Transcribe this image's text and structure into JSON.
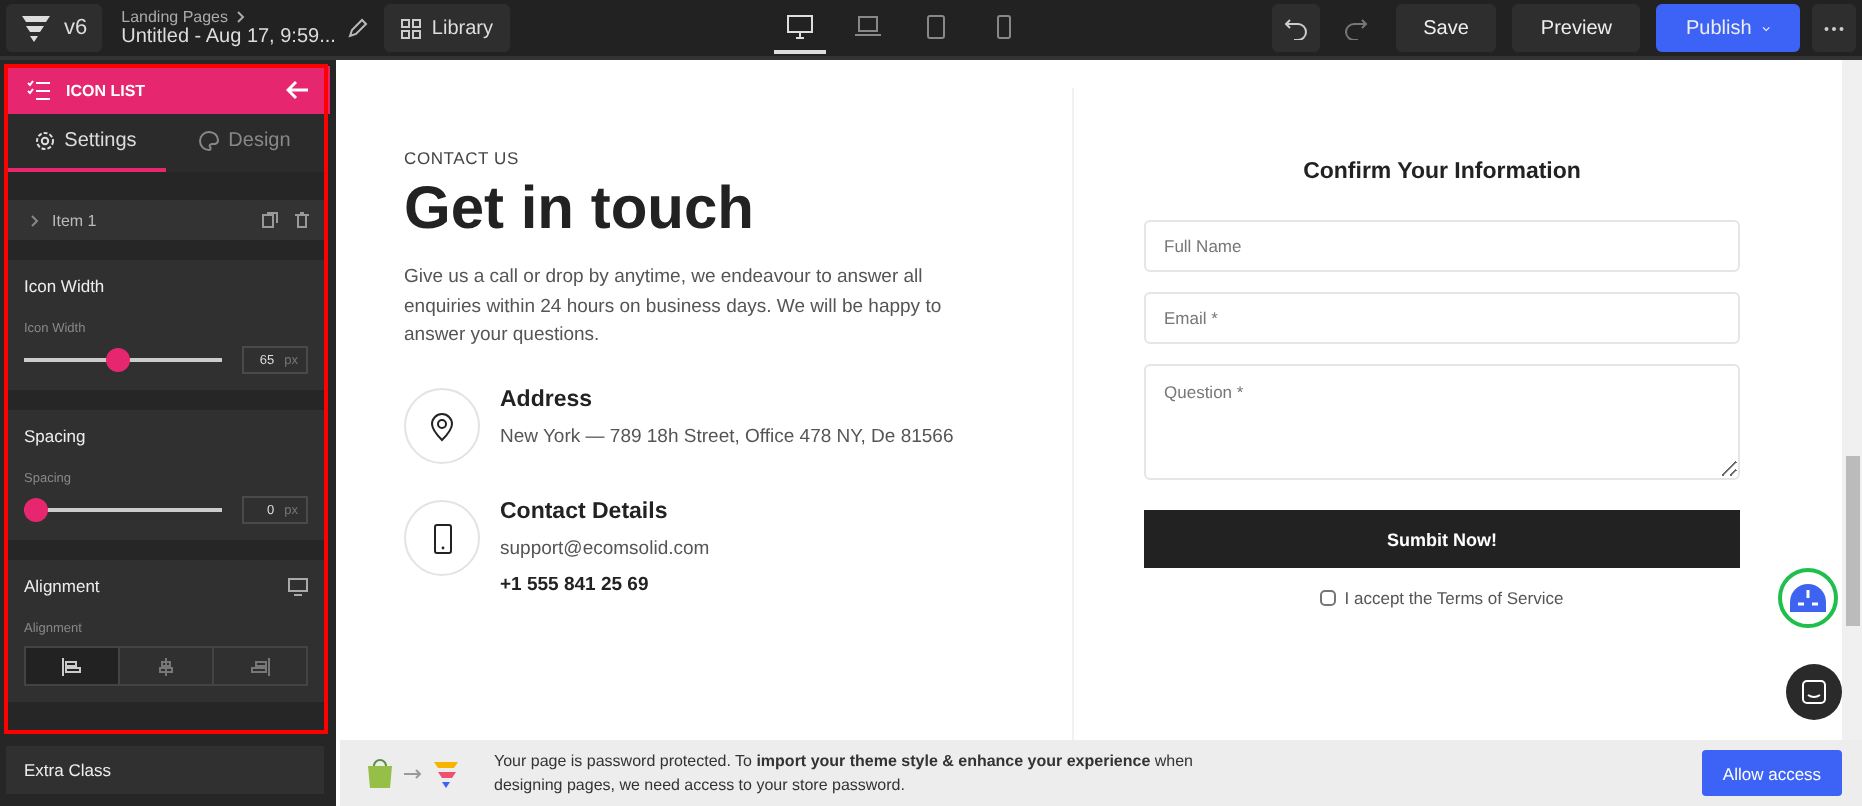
{
  "topbar": {
    "version": "v6",
    "breadcrumb": "Landing Pages",
    "title": "Untitled - Aug 17, 9:59...",
    "library": "Library",
    "devices": [
      {
        "kind": "desktop",
        "selected": true
      },
      {
        "kind": "laptop",
        "selected": false
      },
      {
        "kind": "tablet",
        "selected": false
      },
      {
        "kind": "mobile",
        "selected": false
      }
    ],
    "save": "Save",
    "preview": "Preview",
    "publish": "Publish"
  },
  "panel": {
    "title": "ICON LIST",
    "tabs": [
      {
        "label": "Settings",
        "kind": "gear",
        "selected": true
      },
      {
        "label": "Design",
        "kind": "palette",
        "selected": false
      }
    ],
    "item": "Item 1",
    "sections": [
      {
        "kind": "slider",
        "title": "Icon Width",
        "label": "Icon Width",
        "level": 0.47,
        "value": "65",
        "unit": "px"
      },
      {
        "kind": "slider",
        "title": "Spacing",
        "label": "Spacing",
        "level": 0,
        "value": "0",
        "unit": "px"
      },
      {
        "kind": "align",
        "title": "Alignment",
        "label": "Alignment",
        "options": [
          {
            "selected": true
          },
          {
            "selected": false
          },
          {
            "selected": false
          }
        ]
      }
    ],
    "extra": "Extra Class"
  },
  "content": {
    "eyebrow": "CONTACT US",
    "heading": "Get in touch",
    "intro": "Give us a call or drop by anytime, we endeavour to answer all enquiries within 24 hours on business days. We will be happy to answer your questions.",
    "contacts": [
      {
        "kind": "pin",
        "title": "Address",
        "lines": [
          "New York — 789 18h Street, Office 478 NY, De 81566"
        ]
      },
      {
        "kind": "phone",
        "title": "Contact Details",
        "lines": [
          "support@ecomsolid.com",
          "+1 555 841 25 69"
        ]
      }
    ],
    "form_title": "Confirm Your Information",
    "fields": [
      {
        "kind": "input",
        "placeholder": "Full Name"
      },
      {
        "kind": "input",
        "placeholder": "Email *"
      },
      {
        "kind": "textarea",
        "placeholder": "Question *"
      }
    ],
    "submit": "Sumbit Now!",
    "terms": {
      "label": "I accept the Terms of Service",
      "checked": false
    }
  },
  "notice": {
    "text": "Your page is password protected. To **import your theme style & enhance your experience** when designing pages, we need access to your store password.",
    "button": "Allow access"
  }
}
